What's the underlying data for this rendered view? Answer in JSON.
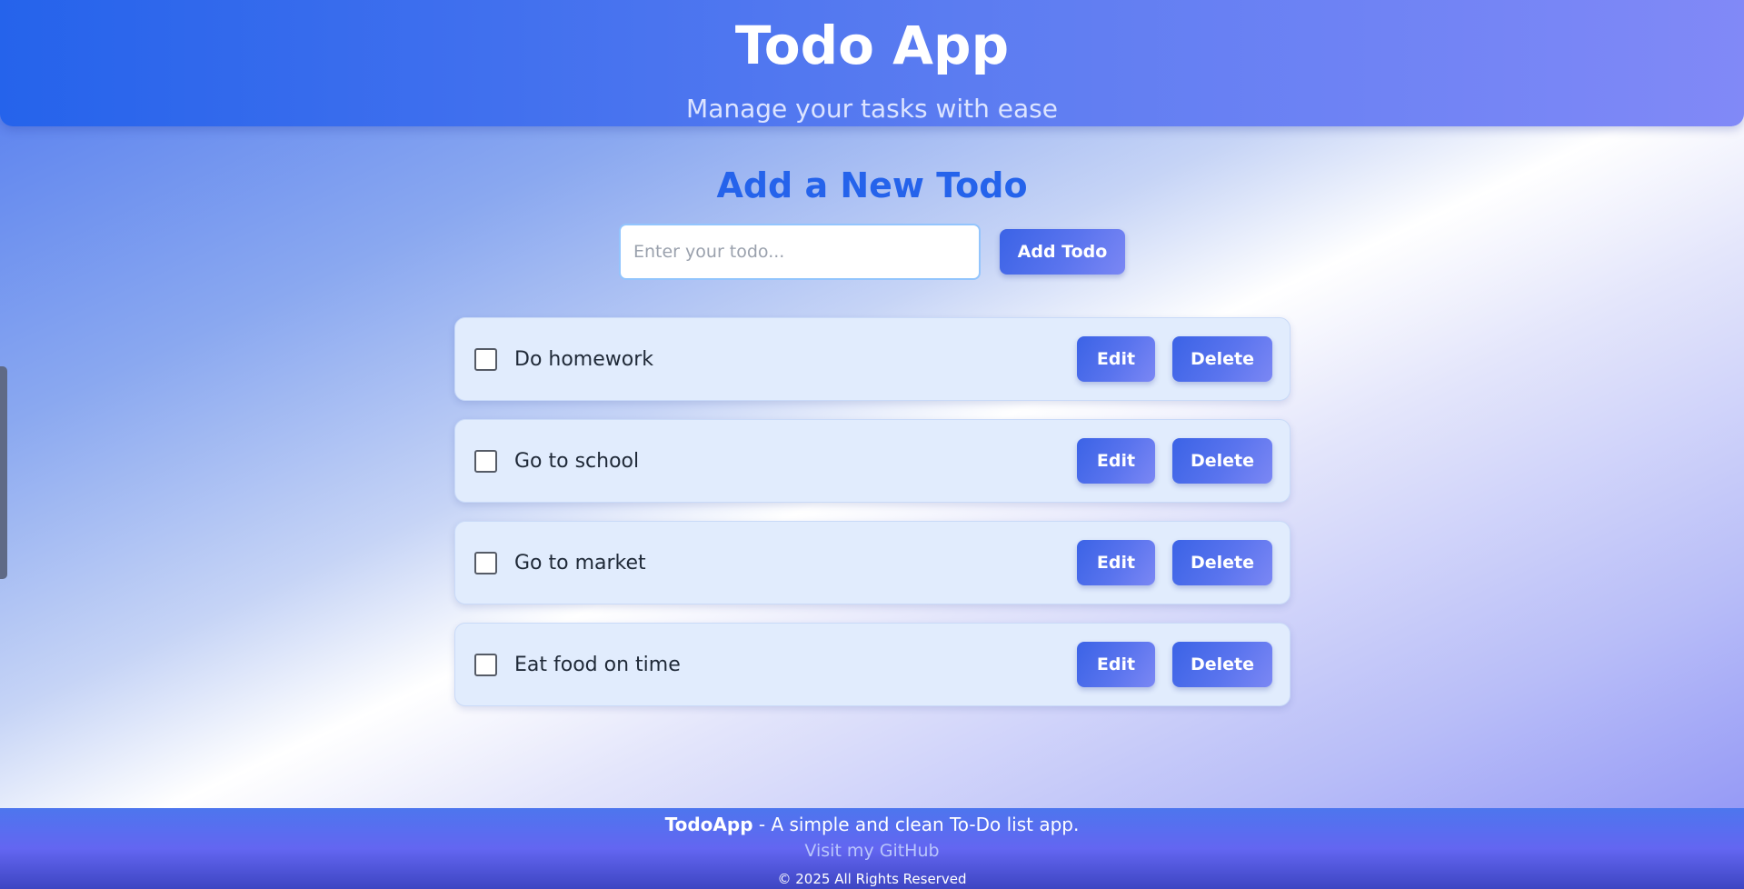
{
  "header": {
    "title": "Todo App",
    "subtitle": "Manage your tasks with ease"
  },
  "form": {
    "heading": "Add a New Todo",
    "input_placeholder": "Enter your todo...",
    "input_value": "",
    "add_button_label": "Add Todo"
  },
  "todos": [
    {
      "text": "Do homework",
      "completed": false,
      "edit_label": "Edit",
      "delete_label": "Delete"
    },
    {
      "text": "Go to school",
      "completed": false,
      "edit_label": "Edit",
      "delete_label": "Delete"
    },
    {
      "text": "Go to market",
      "completed": false,
      "edit_label": "Edit",
      "delete_label": "Delete"
    },
    {
      "text": "Eat food on time",
      "completed": false,
      "edit_label": "Edit",
      "delete_label": "Delete"
    }
  ],
  "footer": {
    "brand": "TodoApp",
    "tagline": " - A simple and clean To-Do list app.",
    "link_label": "Visit my GitHub",
    "copyright": "© 2025 All Rights Reserved"
  },
  "colors": {
    "accent": "#2563eb",
    "header_gradient_start": "#2563eb",
    "header_gradient_end": "#8189f7",
    "todo_card_bg": "#e1ecfd"
  }
}
